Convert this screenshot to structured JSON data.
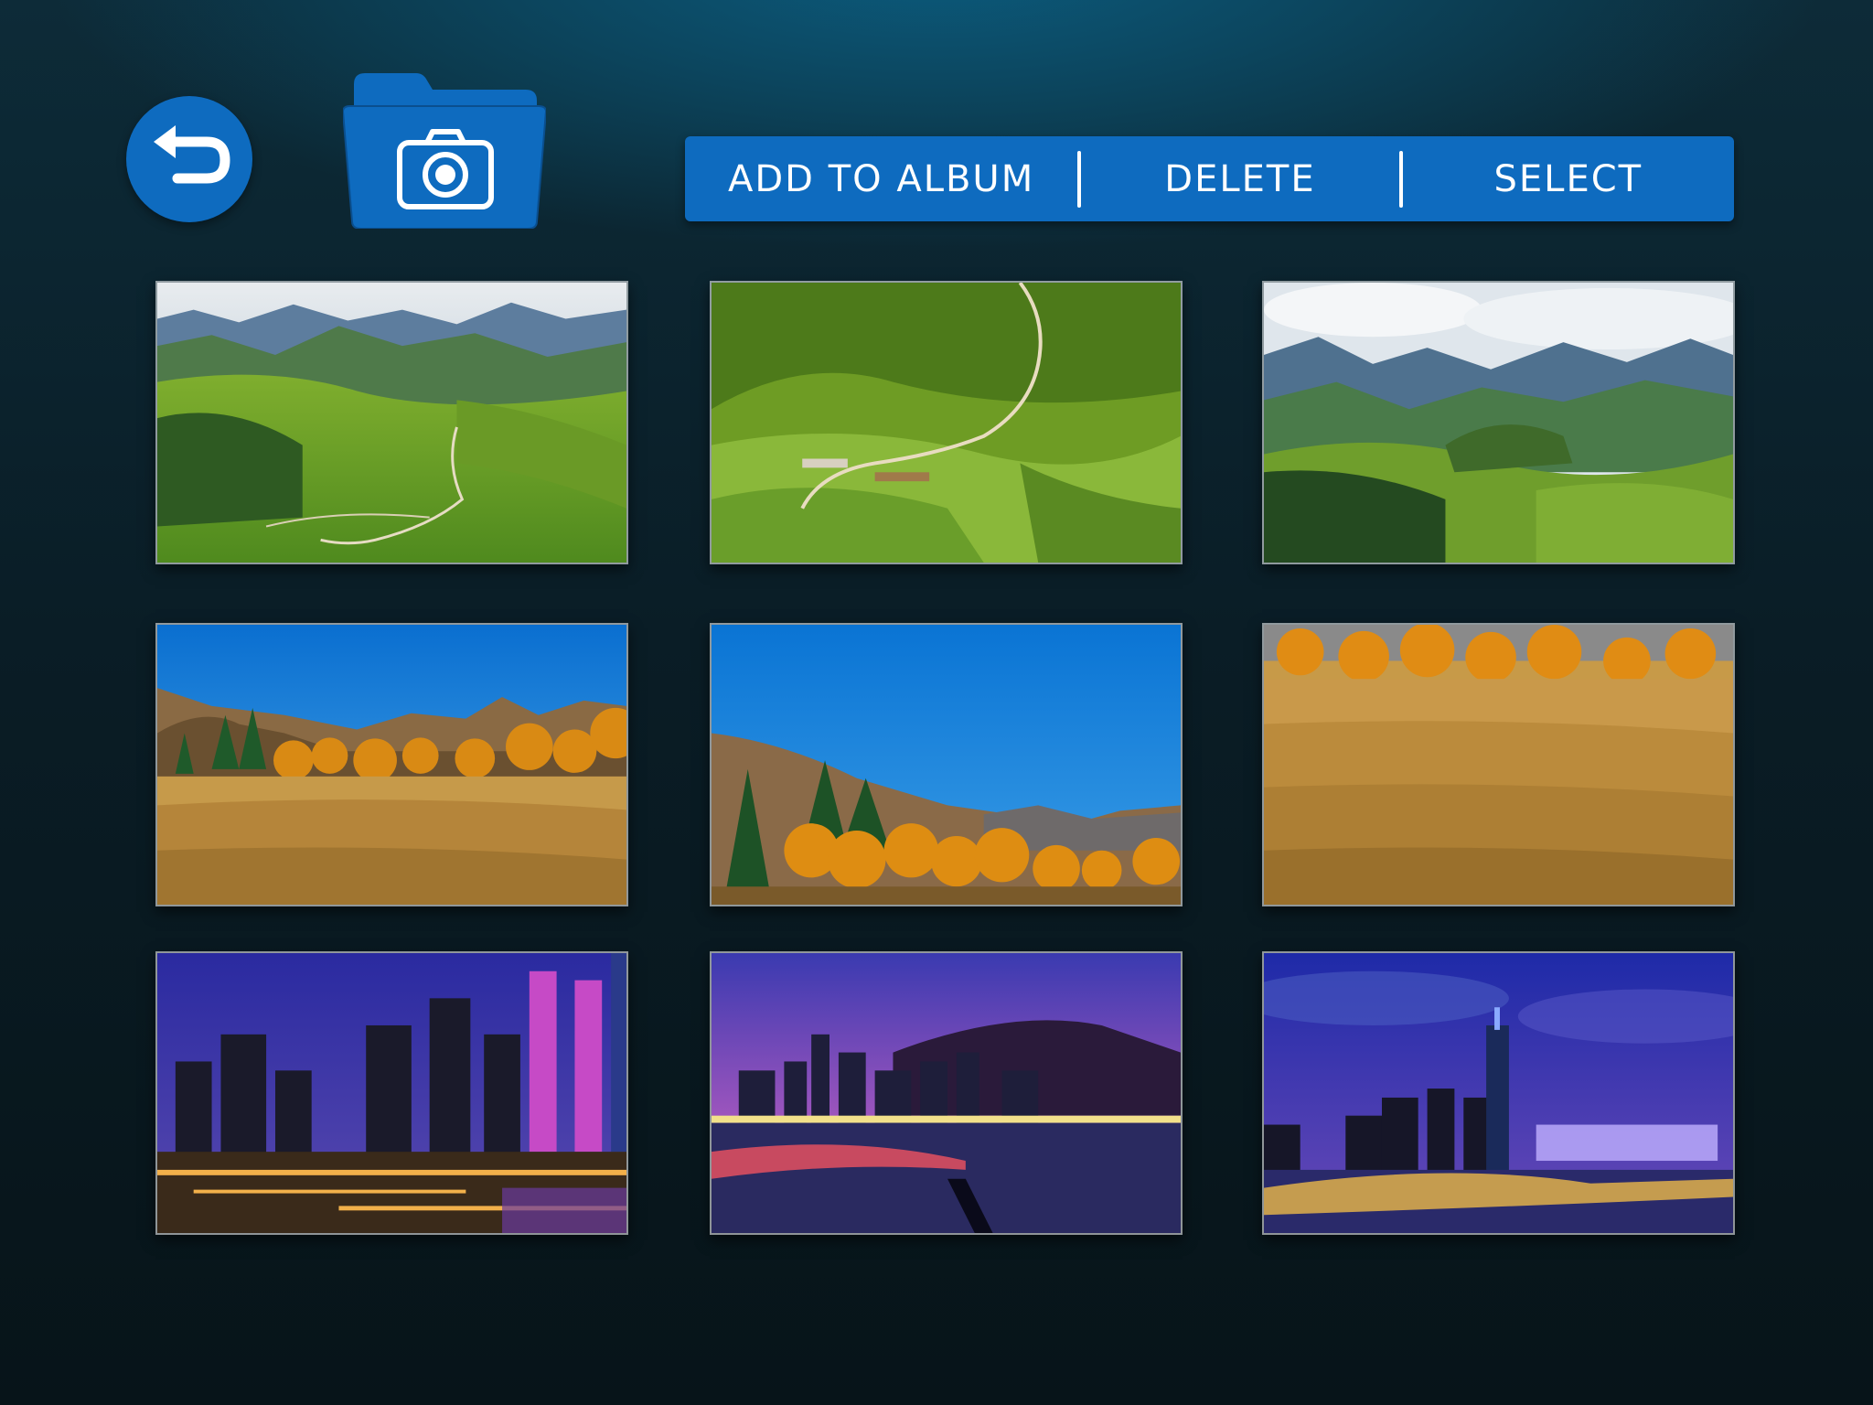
{
  "header": {
    "back_icon": "back-arrow-icon",
    "folder_icon": "camera-folder-icon"
  },
  "toolbar": {
    "add_to_album_label": "ADD TO ALBUM",
    "delete_label": "DELETE",
    "select_label": "SELECT"
  },
  "colors": {
    "accent": "#0e6bbf",
    "background_top": "#0b5b7d",
    "background_bottom": "#071419"
  },
  "gallery": {
    "photos": [
      {
        "scene": "green-mountains"
      },
      {
        "scene": "green-hillside-path"
      },
      {
        "scene": "mountain-valley-clouds"
      },
      {
        "scene": "autumn-meadow-mountains"
      },
      {
        "scene": "autumn-trees-blue-sky"
      },
      {
        "scene": "golden-grass-field"
      },
      {
        "scene": "city-night-towers"
      },
      {
        "scene": "harbor-night-skyline"
      },
      {
        "scene": "city-skyline-waterfront"
      }
    ]
  }
}
